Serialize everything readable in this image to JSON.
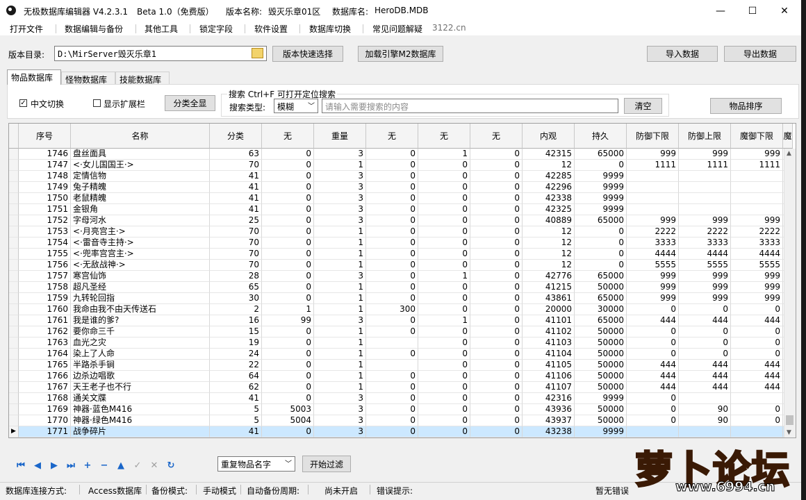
{
  "window": {
    "app_name": "无极数据库编辑器 V4.2.3.1",
    "edition": "Beta 1.0（免费版）",
    "version_label": "版本名称:",
    "version_value": "毁灭乐章01区",
    "db_label": "数据库名:",
    "db_value": "HeroDB.MDB",
    "minimize": "—",
    "maximize": "☐",
    "close": "✕"
  },
  "menu": [
    "打开文件",
    "数据编辑与备份",
    "其他工具",
    "锁定字段",
    "软件设置",
    "数据库切换",
    "常见问题解疑"
  ],
  "menu_extra": "3122.cn",
  "toolbar": {
    "dir_label": "版本目录:",
    "dir_value": "D:\\MirServer毁灭乐章1",
    "quick_select": "版本快速选择",
    "load_engine": "加载引擎M2数据库",
    "import": "导入数据",
    "export": "导出数据"
  },
  "tabs": [
    "物品数据库",
    "怪物数据库",
    "技能数据库"
  ],
  "filters": {
    "chinese_switch": "中文切换",
    "chinese_checked": true,
    "show_ext": "显示扩展栏",
    "show_ext_checked": false,
    "category_all": "分类全显",
    "search_title": "搜索  Ctrl+F 可打开定位搜索",
    "search_type_label": "搜索类型:",
    "search_type_value": "模糊",
    "search_placeholder": "请输入需要搜索的内容",
    "clear": "清空",
    "sort": "物品排序"
  },
  "columns": [
    "序号",
    "名称",
    "分类",
    "无",
    "重量",
    "无",
    "无",
    "无",
    "内观",
    "持久",
    "防御下限",
    "防御上限",
    "魔御下限",
    "魔"
  ],
  "rows": [
    [
      "1746",
      "盘丝面具",
      "63",
      "0",
      "3",
      "0",
      "1",
      "0",
      "42315",
      "65000",
      "999",
      "999",
      "999"
    ],
    [
      "1747",
      "<·女儿国国王·>",
      "70",
      "0",
      "1",
      "0",
      "0",
      "0",
      "12",
      "0",
      "1111",
      "1111",
      "1111"
    ],
    [
      "1748",
      "定情信物",
      "41",
      "0",
      "3",
      "0",
      "0",
      "0",
      "42285",
      "9999",
      "",
      "",
      ""
    ],
    [
      "1749",
      "兔子精魄",
      "41",
      "0",
      "3",
      "0",
      "0",
      "0",
      "42296",
      "9999",
      "",
      "",
      ""
    ],
    [
      "1750",
      "老鼠精魄",
      "41",
      "0",
      "3",
      "0",
      "0",
      "0",
      "42338",
      "9999",
      "",
      "",
      ""
    ],
    [
      "1751",
      "金银角",
      "41",
      "0",
      "3",
      "0",
      "0",
      "0",
      "42325",
      "9999",
      "",
      "",
      ""
    ],
    [
      "1752",
      "字母河水",
      "25",
      "0",
      "3",
      "0",
      "0",
      "0",
      "40889",
      "65000",
      "999",
      "999",
      "999"
    ],
    [
      "1753",
      "<·月亮宫主·>",
      "70",
      "0",
      "1",
      "0",
      "0",
      "0",
      "12",
      "0",
      "2222",
      "2222",
      "2222"
    ],
    [
      "1754",
      "<·雷音寺主持·>",
      "70",
      "0",
      "1",
      "0",
      "0",
      "0",
      "12",
      "0",
      "3333",
      "3333",
      "3333"
    ],
    [
      "1755",
      "<·兜率宫宫主·>",
      "70",
      "0",
      "1",
      "0",
      "0",
      "0",
      "12",
      "0",
      "4444",
      "4444",
      "4444"
    ],
    [
      "1756",
      "<·无敌战神·>",
      "70",
      "0",
      "1",
      "0",
      "0",
      "0",
      "12",
      "0",
      "5555",
      "5555",
      "5555"
    ],
    [
      "1757",
      "寒宫仙饰",
      "28",
      "0",
      "3",
      "0",
      "1",
      "0",
      "42776",
      "65000",
      "999",
      "999",
      "999"
    ],
    [
      "1758",
      "超凡圣经",
      "65",
      "0",
      "1",
      "0",
      "0",
      "0",
      "41215",
      "50000",
      "999",
      "999",
      "999"
    ],
    [
      "1759",
      "九转轮回指",
      "30",
      "0",
      "1",
      "0",
      "0",
      "0",
      "43861",
      "65000",
      "999",
      "999",
      "999"
    ],
    [
      "1760",
      "我命由我不由天传送石",
      "2",
      "1",
      "1",
      "300",
      "0",
      "0",
      "20000",
      "30000",
      "0",
      "0",
      "0"
    ],
    [
      "1761",
      "我是谁的爹?",
      "16",
      "99",
      "3",
      "0",
      "1",
      "0",
      "41101",
      "65000",
      "444",
      "444",
      "444"
    ],
    [
      "1762",
      "要你命三千",
      "15",
      "0",
      "1",
      "0",
      "0",
      "0",
      "41102",
      "50000",
      "0",
      "0",
      "0"
    ],
    [
      "1763",
      "血光之灾",
      "19",
      "0",
      "1",
      "",
      "0",
      "0",
      "41103",
      "50000",
      "0",
      "0",
      "0"
    ],
    [
      "1764",
      "染上了人命",
      "24",
      "0",
      "1",
      "0",
      "0",
      "0",
      "41104",
      "50000",
      "0",
      "0",
      "0"
    ],
    [
      "1765",
      "半路杀手锏",
      "22",
      "0",
      "1",
      "",
      "0",
      "0",
      "41105",
      "50000",
      "444",
      "444",
      "444"
    ],
    [
      "1766",
      "边杀边唱歌",
      "64",
      "0",
      "1",
      "0",
      "0",
      "0",
      "41106",
      "50000",
      "444",
      "444",
      "444"
    ],
    [
      "1767",
      "天王老子也不行",
      "62",
      "0",
      "1",
      "0",
      "0",
      "0",
      "41107",
      "50000",
      "444",
      "444",
      "444"
    ],
    [
      "1768",
      "通关文牒",
      "41",
      "0",
      "3",
      "0",
      "0",
      "0",
      "42316",
      "9999",
      "0",
      "",
      ""
    ],
    [
      "1769",
      "神器·蓝色M416",
      "5",
      "5003",
      "3",
      "0",
      "0",
      "0",
      "43936",
      "50000",
      "0",
      "90",
      "0"
    ],
    [
      "1770",
      "神器·绿色M416",
      "5",
      "5004",
      "3",
      "0",
      "0",
      "0",
      "43937",
      "50000",
      "0",
      "90",
      "0"
    ],
    [
      "1771",
      "战争碎片",
      "41",
      "0",
      "3",
      "0",
      "0",
      "0",
      "43238",
      "9999",
      "",
      "",
      ""
    ]
  ],
  "selected_row_index": 25,
  "bottom": {
    "nav_icons": [
      "first-icon",
      "prev-icon",
      "next-icon",
      "last-icon",
      "add-icon",
      "delete-icon",
      "up-icon",
      "confirm-icon",
      "cancel-icon",
      "refresh-icon"
    ],
    "nav_glyphs": [
      "⏮",
      "◀",
      "▶",
      "⏭",
      "+",
      "−",
      "▲",
      "✓",
      "✕",
      "↻"
    ],
    "filter_select": "重复物品名字",
    "start_filter": "开始过滤"
  },
  "status": {
    "conn_label": "数据库连接方式:",
    "conn_value": "Access数据库",
    "backup_label": "备份模式:",
    "backup_value": "手动模式",
    "auto_label": "自动备份周期:",
    "auto_value": "尚未开启",
    "err_label": "错误提示:",
    "err_value": "暂无错误"
  },
  "logo": {
    "text": "萝卜论坛",
    "url": "www.6994.cn"
  },
  "colors": {
    "accent_nav": "#1a66c9",
    "selection": "#cce8ff",
    "logo_orange": "#f28c1c"
  }
}
